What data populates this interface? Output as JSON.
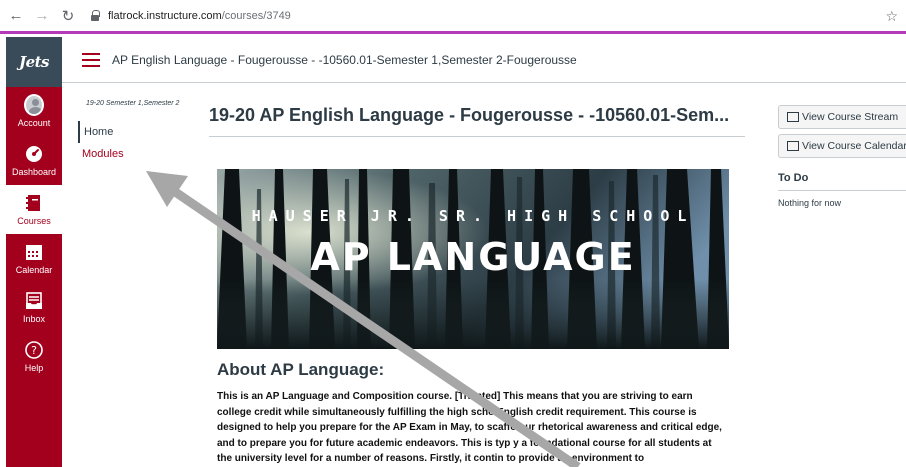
{
  "browser": {
    "url_host": "flatrock.instructure.com",
    "url_path": "/courses/3749"
  },
  "global_nav": {
    "logo": "Jets",
    "items": [
      {
        "label": "Account",
        "icon": "avatar-icon"
      },
      {
        "label": "Dashboard",
        "icon": "dashboard-icon"
      },
      {
        "label": "Courses",
        "icon": "book-icon",
        "active": true
      },
      {
        "label": "Calendar",
        "icon": "calendar-icon"
      },
      {
        "label": "Inbox",
        "icon": "inbox-icon"
      },
      {
        "label": "Help",
        "icon": "help-icon"
      }
    ]
  },
  "header": {
    "breadcrumb": "AP English Language - Fougerousse - -10560.01-Semester 1,Semester 2-Fougerousse"
  },
  "course_nav": {
    "term": "19-20 Semester 1,Semester 2",
    "items": [
      {
        "label": "Home",
        "active": true
      },
      {
        "label": "Modules",
        "active": false
      }
    ]
  },
  "main": {
    "title": "19-20 AP English Language - Fougerousse - -10560.01-Sem...",
    "banner": {
      "school": "HAUSER JR. SR. HIGH SCHOOL",
      "title": "AP LANGUAGE"
    },
    "about_heading": "About AP Language:",
    "about_body": "This is an AP Language and Composition course. [Tra    nted] This means that you are striving to earn college credit while simultaneously fulfilling the high scho    English credit requirement. This course is designed to help you prepare for the AP Exam in May, to scaffo    our rhetorical awareness and critical edge, and to prepare you for future academic endeavors. This is typ    y a foundational course for all students at the university level for a number of reasons. Firstly, it contin    to provide an environment to"
  },
  "sidebar": {
    "stream_button": "View Course Stream",
    "calendar_button": "View Course Calendar",
    "todo_heading": "To Do",
    "todo_empty": "Nothing for now"
  },
  "colors": {
    "brand": "#a3001e",
    "logo_strip": "#394b58",
    "annotation_arrow": "#a7a7a7"
  }
}
